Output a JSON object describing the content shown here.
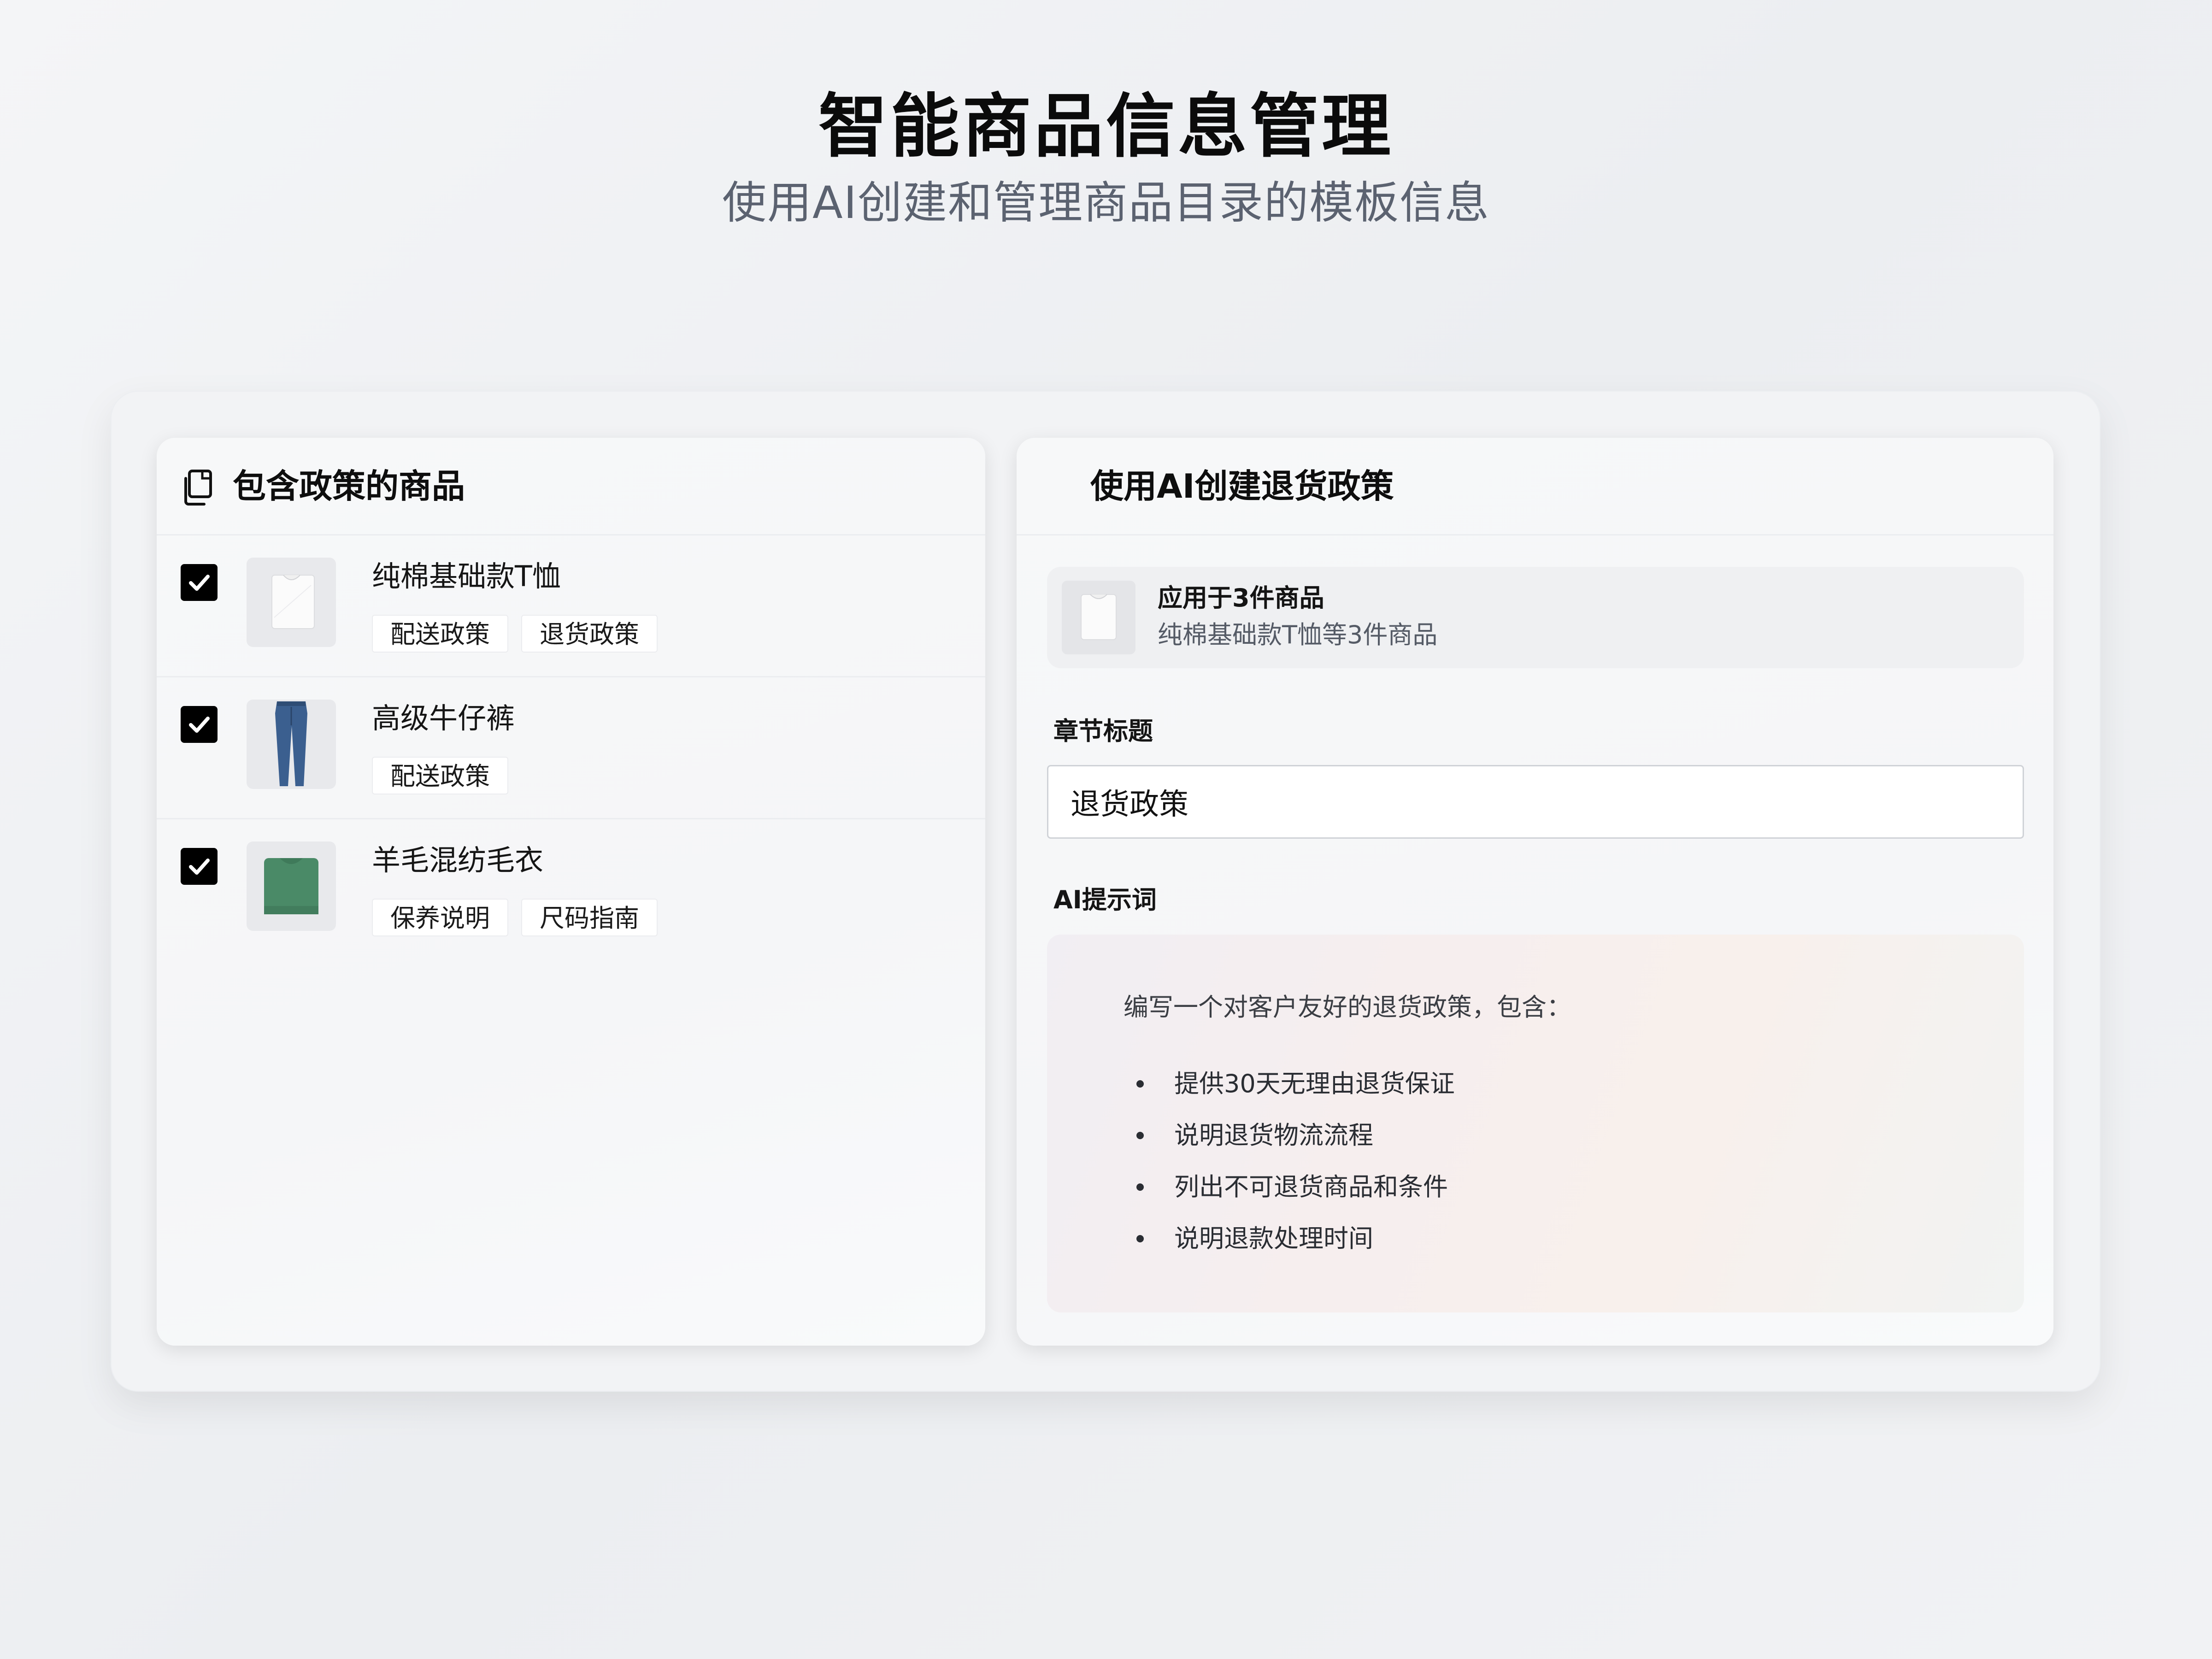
{
  "hero": {
    "title": "智能商品信息管理",
    "subtitle": "使用AI创建和管理商品目录的模板信息"
  },
  "left_panel": {
    "icon": "copy-icon",
    "title": "包含政策的商品",
    "products": [
      {
        "name": "纯棉基础款T恤",
        "checked": true,
        "thumb_icon": "white-tshirt-icon",
        "tags": [
          "配送政策",
          "退货政策"
        ]
      },
      {
        "name": "高级牛仔裤",
        "checked": true,
        "thumb_icon": "blue-jeans-icon",
        "tags": [
          "配送政策"
        ]
      },
      {
        "name": "羊毛混纺毛衣",
        "checked": true,
        "thumb_icon": "green-sweater-icon",
        "tags": [
          "保养说明",
          "尺码指南"
        ]
      }
    ]
  },
  "right_panel": {
    "title": "使用AI创建退货政策",
    "applies": {
      "thumb_icon": "white-tshirt-icon",
      "title": "应用于3件商品",
      "subtitle": "纯棉基础款T恤等3件商品"
    },
    "section_title_label": "章节标题",
    "section_title_value": "退货政策",
    "prompt_label": "AI提示词",
    "prompt": {
      "intro": "编写一个对客户友好的退货政策，包含：",
      "bullets": [
        "提供30天无理由退货保证",
        "说明退货物流流程",
        "列出不可退货商品和条件",
        "说明退款处理时间"
      ]
    }
  },
  "colors": {
    "checkbox": "#000000",
    "jeans": "#3b5f8f",
    "sweater": "#4a8a67"
  }
}
